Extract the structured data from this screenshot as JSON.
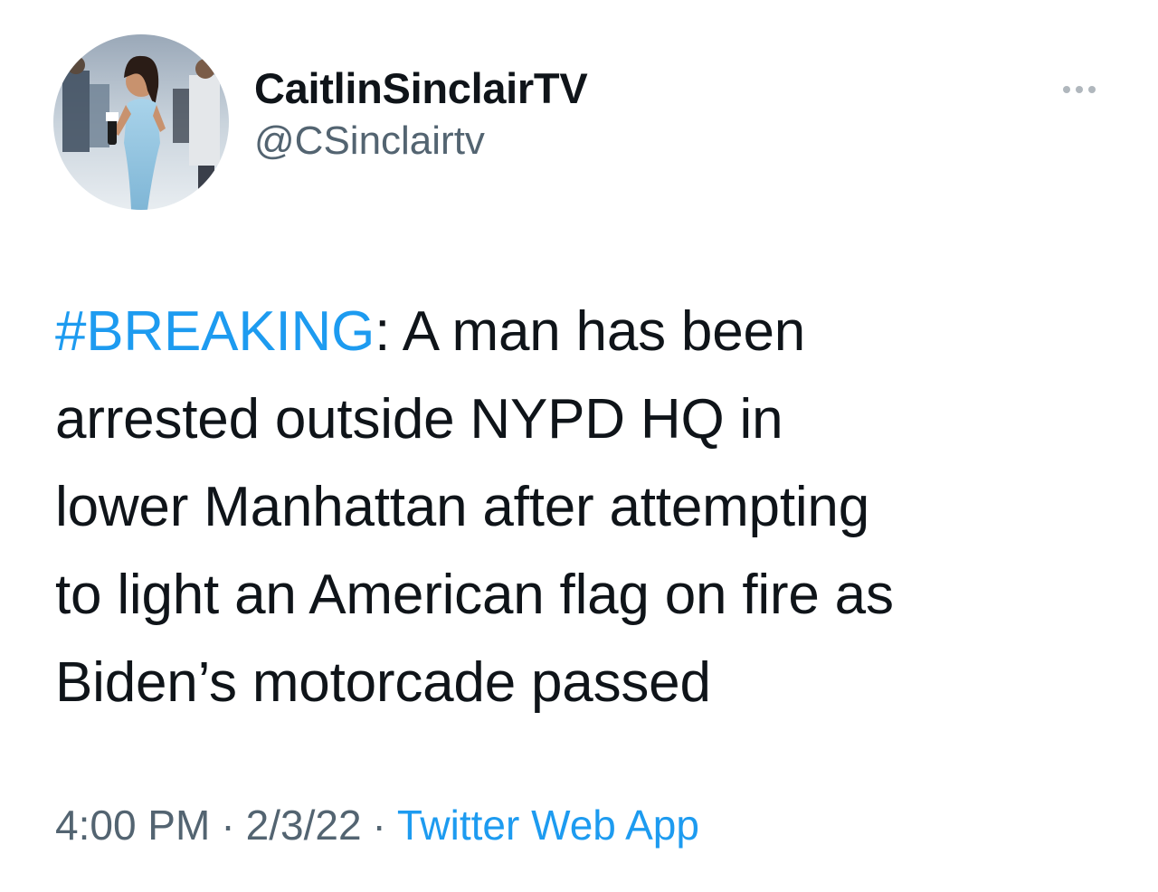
{
  "author": {
    "display_name": "CaitlinSinclairTV",
    "handle": "@CSinclairtv"
  },
  "tweet": {
    "hashtag": "#BREAKING",
    "text_line1": ": A man has been",
    "text_line2": "arrested outside NYPD HQ in",
    "text_line3": "lower Manhattan after attempting",
    "text_line4": "to light an American flag on fire as",
    "text_line5": "Biden’s motorcade passed"
  },
  "meta": {
    "time": "4:00 PM",
    "separator": "·",
    "date": "2/3/22",
    "source": "Twitter Web App"
  },
  "icons": {
    "more": "more-options-icon"
  },
  "colors": {
    "link": "#1d9bf0",
    "secondary": "#536471",
    "primary_text": "#0f1419"
  }
}
